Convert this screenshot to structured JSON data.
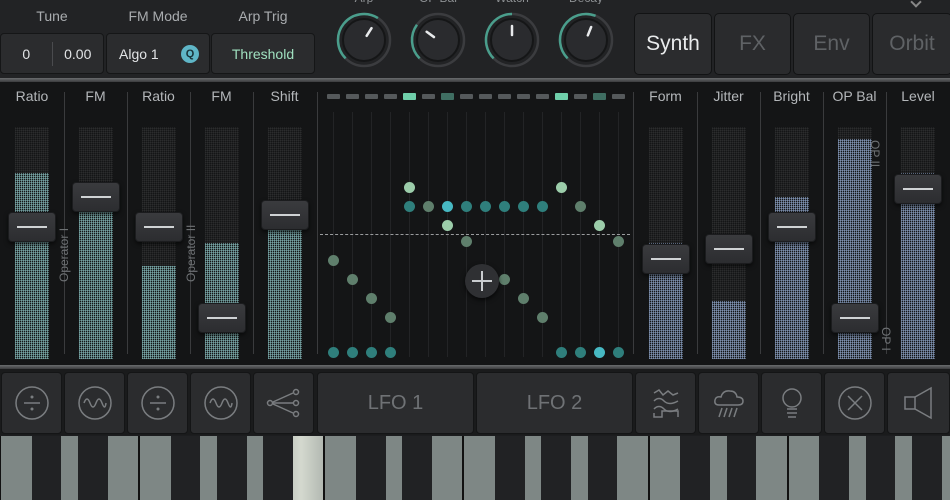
{
  "header": {
    "tune_label": "Tune",
    "tune_coarse": "0",
    "tune_fine": "0.00",
    "fm_mode_label": "FM Mode",
    "fm_mode_value": "Algo 1",
    "fm_mode_badge": "Q",
    "arp_trig_label": "Arp Trig",
    "arp_trig_value": "Threshold",
    "knobs": [
      {
        "label": "Arp",
        "value": 0.62
      },
      {
        "label": "OP Bal",
        "value": 0.3
      },
      {
        "label": "Watch",
        "value": 0.5
      },
      {
        "label": "Decay",
        "value": 0.58
      }
    ],
    "tabs": [
      {
        "label": "Synth",
        "active": true
      },
      {
        "label": "FX",
        "active": false
      },
      {
        "label": "Env",
        "active": false
      },
      {
        "label": "Orbit",
        "active": false
      }
    ]
  },
  "operators": {
    "op1_label": "Operator I",
    "op2_label": "Operator II",
    "op_bal_top": "OP II",
    "op_bal_bottom": "OP I"
  },
  "sliders": [
    {
      "label": "Ratio",
      "value": 0.53,
      "fill": 0.8
    },
    {
      "label": "FM",
      "value": 0.68,
      "fill": 0.7
    },
    {
      "label": "Ratio",
      "value": 0.53,
      "fill": 0.4
    },
    {
      "label": "FM",
      "value": 0.08,
      "fill": 0.5
    },
    {
      "label": "Shift",
      "value": 0.59,
      "fill": 0.6
    },
    {
      "label": "Form",
      "value": 0.37,
      "fill": 0.5
    },
    {
      "label": "Jitter",
      "value": 0.42,
      "fill": 0.25
    },
    {
      "label": "Bright",
      "value": 0.53,
      "fill": 0.7
    },
    {
      "label": "OP Bal",
      "value": 0.08,
      "fill": 0.95
    },
    {
      "label": "Level",
      "value": 0.72,
      "fill": 0.8
    }
  ],
  "sequencer": {
    "steps": 16,
    "top_markers": [
      "off",
      "off",
      "off",
      "off",
      "on",
      "off",
      "half",
      "off",
      "off",
      "off",
      "off",
      "off",
      "on",
      "off",
      "half",
      "off"
    ],
    "dots": [
      {
        "step": 0,
        "level": 0.34,
        "tone": "mid"
      },
      {
        "step": 0,
        "level": 0.0,
        "tone": "teal"
      },
      {
        "step": 1,
        "level": 0.27,
        "tone": "mid"
      },
      {
        "step": 1,
        "level": 0.0,
        "tone": "teal"
      },
      {
        "step": 2,
        "level": 0.2,
        "tone": "mid"
      },
      {
        "step": 2,
        "level": 0.0,
        "tone": "teal"
      },
      {
        "step": 3,
        "level": 0.13,
        "tone": "mid"
      },
      {
        "step": 3,
        "level": 0.0,
        "tone": "teal"
      },
      {
        "step": 4,
        "level": 0.61,
        "tone": "light"
      },
      {
        "step": 4,
        "level": 0.54,
        "tone": "teal"
      },
      {
        "step": 5,
        "level": 0.54,
        "tone": "mid"
      },
      {
        "step": 6,
        "level": 0.54,
        "tone": "bright"
      },
      {
        "step": 6,
        "level": 0.47,
        "tone": "light"
      },
      {
        "step": 7,
        "level": 0.54,
        "tone": "teal"
      },
      {
        "step": 7,
        "level": 0.41,
        "tone": "mid"
      },
      {
        "step": 8,
        "level": 0.54,
        "tone": "teal"
      },
      {
        "step": 9,
        "level": 0.54,
        "tone": "teal"
      },
      {
        "step": 9,
        "level": 0.27,
        "tone": "mid"
      },
      {
        "step": 10,
        "level": 0.54,
        "tone": "teal"
      },
      {
        "step": 10,
        "level": 0.2,
        "tone": "mid"
      },
      {
        "step": 11,
        "level": 0.54,
        "tone": "teal"
      },
      {
        "step": 11,
        "level": 0.13,
        "tone": "mid"
      },
      {
        "step": 12,
        "level": 0.61,
        "tone": "light"
      },
      {
        "step": 12,
        "level": 0.0,
        "tone": "teal"
      },
      {
        "step": 13,
        "level": 0.54,
        "tone": "mid"
      },
      {
        "step": 13,
        "level": 0.0,
        "tone": "teal"
      },
      {
        "step": 14,
        "level": 0.47,
        "tone": "light"
      },
      {
        "step": 14,
        "level": 0.0,
        "tone": "bright"
      },
      {
        "step": 15,
        "level": 0.41,
        "tone": "mid"
      },
      {
        "step": 15,
        "level": 0.0,
        "tone": "teal"
      }
    ],
    "colors": {
      "teal": "#2f7f7c",
      "bright": "#47b9c3",
      "mid": "#5f7f6c",
      "light": "#9ccdaa"
    }
  },
  "buttons": [
    {
      "icon": "divide-icon"
    },
    {
      "icon": "sine-wave-icon"
    },
    {
      "icon": "divide-icon"
    },
    {
      "icon": "sine-wave-icon"
    },
    {
      "icon": "routing-icon"
    },
    {
      "label": "LFO 1"
    },
    {
      "label": "LFO 2"
    },
    {
      "icon": "waves-icon"
    },
    {
      "icon": "rain-cloud-icon"
    },
    {
      "icon": "lightbulb-icon"
    },
    {
      "icon": "close-circle-icon"
    },
    {
      "icon": "speaker-icon"
    }
  ],
  "keyboard": {
    "lit_key_index": 6
  },
  "colors": {
    "accent_green": "#9fe0bf",
    "accent_teal": "#5fb6c7",
    "knob_arc": "#4a9e8c"
  }
}
